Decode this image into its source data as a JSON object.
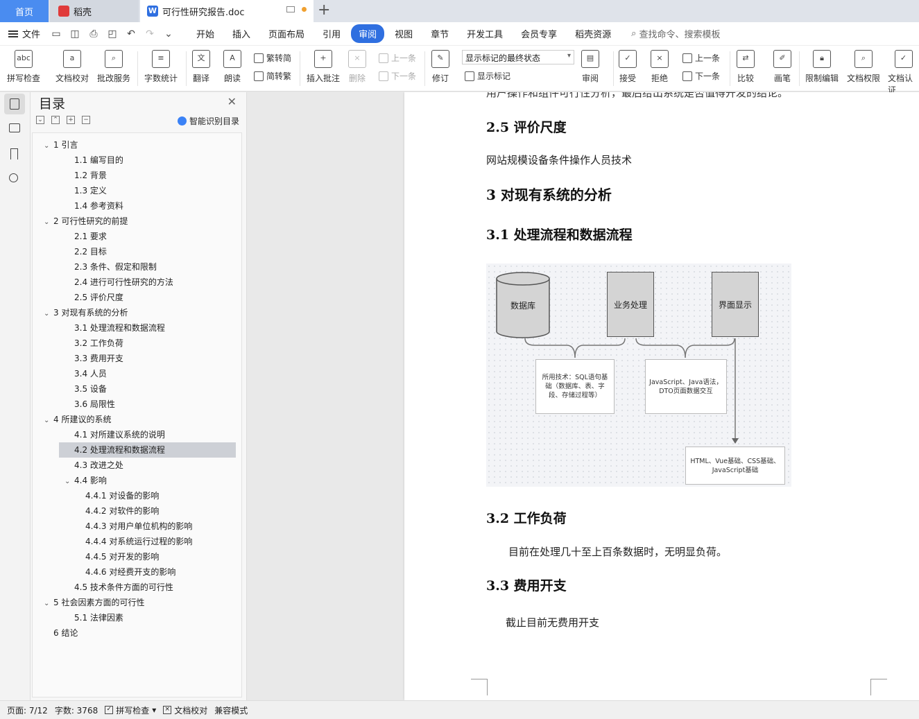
{
  "tabs": {
    "home": "首页",
    "daoke": "稻壳",
    "document": "可行性研究报告.doc",
    "new_tab": "+"
  },
  "menubar": {
    "file": "文件",
    "tabs": [
      "开始",
      "插入",
      "页面布局",
      "引用",
      "审阅",
      "视图",
      "章节",
      "开发工具",
      "会员专享",
      "稻壳资源"
    ],
    "active_tab": "审阅",
    "search": "查找命令、搜索模板"
  },
  "ribbon": {
    "spell_check": "拼写检查",
    "doc_proof": "文档校对",
    "batch_service": "批改服务",
    "word_count": "字数统计",
    "translate": "翻译",
    "read_aloud": "朗读",
    "to_traditional": "繁转简",
    "to_simplified": "简转繁",
    "insert_comment": "插入批注",
    "delete": "删除",
    "prev": "上一条",
    "next": "下一条",
    "track_changes": "修订",
    "markup_select": "显示标记的最终状态",
    "show_markup": "显示标记",
    "review": "审阅",
    "accept": "接受",
    "reject": "拒绝",
    "prev2": "上一条",
    "next2": "下一条",
    "compare": "比较",
    "pen": "画笔",
    "restrict_edit": "限制编辑",
    "doc_rights": "文档权限",
    "doc_cert": "文档认证"
  },
  "toc": {
    "title": "目录",
    "smart": "智能识别目录",
    "items": [
      {
        "label": "1 引言",
        "level": 1,
        "chevron": true
      },
      {
        "label": "1.1 编写目的",
        "level": 2
      },
      {
        "label": "1.2 背景",
        "level": 2
      },
      {
        "label": "1.3 定义",
        "level": 2
      },
      {
        "label": "1.4 参考资料",
        "level": 2
      },
      {
        "label": "2 可行性研究的前提",
        "level": 1,
        "chevron": true
      },
      {
        "label": "2.1 要求",
        "level": 2
      },
      {
        "label": "2.2 目标",
        "level": 2
      },
      {
        "label": "2.3 条件、假定和限制",
        "level": 2
      },
      {
        "label": "2.4 进行可行性研究的方法",
        "level": 2
      },
      {
        "label": "2.5 评价尺度",
        "level": 2
      },
      {
        "label": "3 对现有系统的分析",
        "level": 1,
        "chevron": true
      },
      {
        "label": "3.1 处理流程和数据流程",
        "level": 2
      },
      {
        "label": "3.2 工作负荷",
        "level": 2
      },
      {
        "label": "3.3 费用开支",
        "level": 2
      },
      {
        "label": "3.4 人员",
        "level": 2
      },
      {
        "label": "3.5 设备",
        "level": 2
      },
      {
        "label": "3.6 局限性",
        "level": 2
      },
      {
        "label": "4 所建议的系统",
        "level": 1,
        "chevron": true
      },
      {
        "label": "4.1 对所建议系统的说明",
        "level": 2
      },
      {
        "label": "4.2 处理流程和数据流程",
        "level": 2,
        "selected": true
      },
      {
        "label": "4.3 改进之处",
        "level": 2
      },
      {
        "label": "4.4 影响",
        "level": 2,
        "chevron": true
      },
      {
        "label": "4.4.1 对设备的影响",
        "level": 3
      },
      {
        "label": "4.4.2 对软件的影响",
        "level": 3
      },
      {
        "label": "4.4.3 对用户单位机构的影响",
        "level": 3
      },
      {
        "label": "4.4.4 对系统运行过程的影响",
        "level": 3
      },
      {
        "label": "4.4.5 对开发的影响",
        "level": 3
      },
      {
        "label": "4.4.6 对经费开支的影响",
        "level": 3
      },
      {
        "label": "4.5 技术条件方面的可行性",
        "level": 2
      },
      {
        "label": "5 社会因素方面的可行性",
        "level": 1,
        "chevron": true
      },
      {
        "label": "5.1 法律因素",
        "level": 2
      },
      {
        "label": "6 结论",
        "level": 1
      }
    ]
  },
  "document": {
    "cut_line": "用户操作和组件可行性分析，最后给出系统是否值得开发的结论。",
    "h_2_5": "2.5 评价尺度",
    "p_2_5": "网站规模设备条件操作人员技术",
    "h_3": "3 对现有系统的分析",
    "h_3_1": "3.1 处理流程和数据流程",
    "diagram": {
      "database": "数据库",
      "business": "业务处理",
      "display": "界面显示",
      "note_db": "所用技术：SQL语句基础（数据库、表、字段、存储过程等）",
      "note_biz": "JavaScript、Java语法，DTO页面数据交互",
      "note_ui": "HTML、Vue基础、CSS基础、JavaScript基础"
    },
    "h_3_2": "3.2 工作负荷",
    "p_3_2": "目前在处理几十至上百条数据时，无明显负荷。",
    "h_3_3": "3.3 费用开支",
    "p_3_3": "截止目前无费用开支"
  },
  "statusbar": {
    "page": "页面: 7/12",
    "words": "字数: 3768",
    "spell": "拼写检查",
    "proof": "文档校对",
    "compat": "兼容模式"
  }
}
